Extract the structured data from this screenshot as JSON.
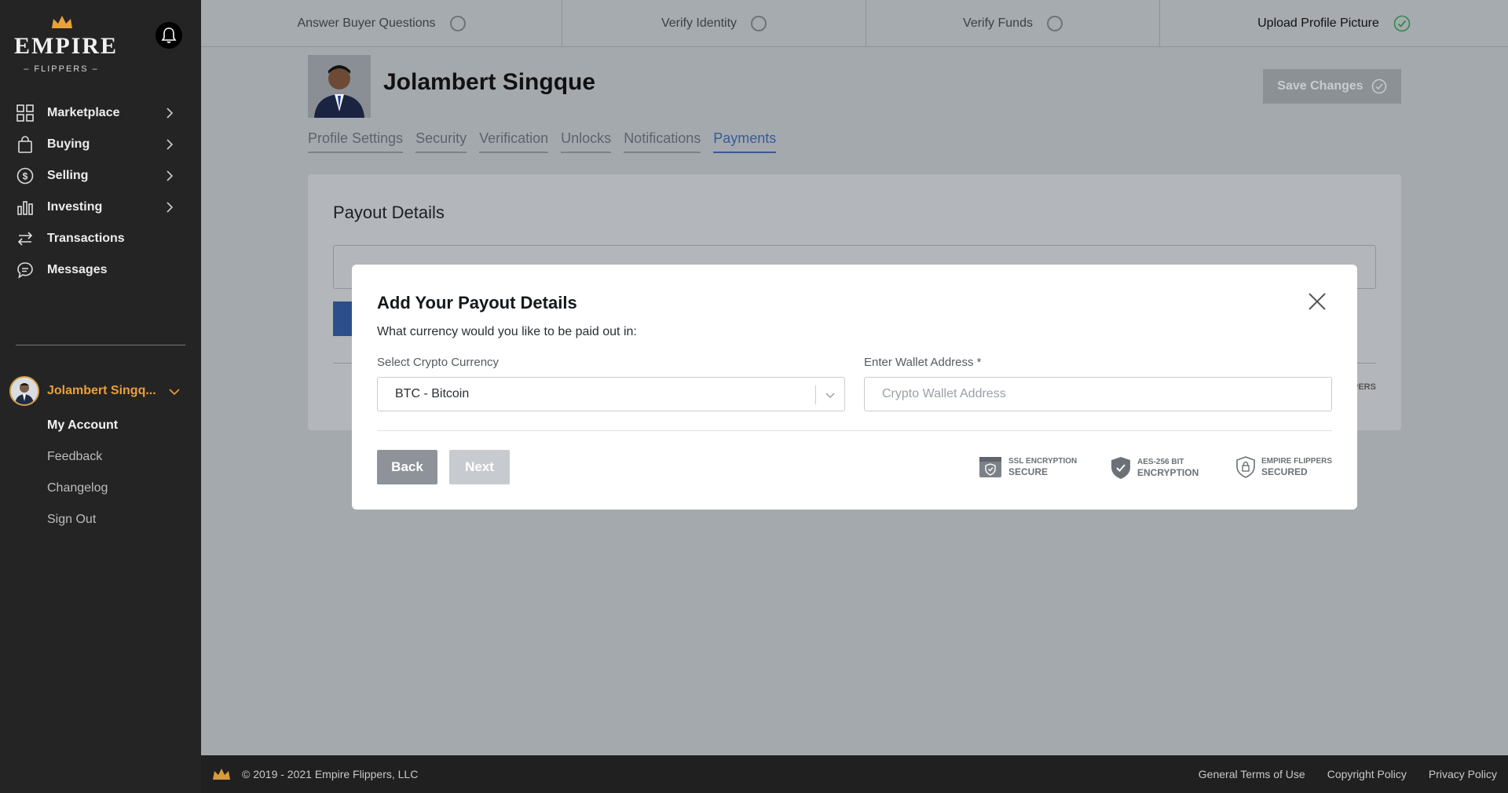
{
  "brand": {
    "name": "EMPIRE",
    "sub": "FLIPPERS"
  },
  "sidebar": {
    "items": [
      {
        "label": "Marketplace",
        "icon": "grid-icon",
        "has_chevron": true
      },
      {
        "label": "Buying",
        "icon": "shopping-bag-icon",
        "has_chevron": true
      },
      {
        "label": "Selling",
        "icon": "dollar-circle-icon",
        "has_chevron": true
      },
      {
        "label": "Investing",
        "icon": "bar-chart-icon",
        "has_chevron": true
      },
      {
        "label": "Transactions",
        "icon": "arrows-swap-icon",
        "has_chevron": false
      },
      {
        "label": "Messages",
        "icon": "chat-bubble-icon",
        "has_chevron": false
      }
    ],
    "user": {
      "name": "Jolambert Singq..."
    },
    "account_menu": [
      "My Account",
      "Feedback",
      "Changelog",
      "Sign Out"
    ]
  },
  "steps": [
    {
      "label": "Answer Buyer Questions",
      "done": false
    },
    {
      "label": "Verify Identity",
      "done": false
    },
    {
      "label": "Verify Funds",
      "done": false
    },
    {
      "label": "Upload Profile Picture",
      "done": true
    }
  ],
  "profile": {
    "name": "Jolambert Singque",
    "save_label": "Save Changes",
    "tabs": [
      "Profile Settings",
      "Security",
      "Verification",
      "Unlocks",
      "Notifications",
      "Payments"
    ],
    "active_tab": "Payments"
  },
  "card": {
    "title": "Payout Details",
    "partial_badge": "PERS"
  },
  "modal": {
    "title": "Add Your Payout Details",
    "subtitle": "What currency would you like to be paid out in:",
    "currency_label": "Select Crypto Currency",
    "currency_value": "BTC - Bitcoin",
    "wallet_label": "Enter Wallet Address *",
    "wallet_placeholder": "Crypto Wallet Address",
    "wallet_value": "",
    "back_label": "Back",
    "next_label": "Next",
    "badges": [
      {
        "line1": "SSL ENCRYPTION",
        "line2": "SECURE",
        "icon": "ssl-browser-icon"
      },
      {
        "line1": "AES-256 BIT",
        "line2": "ENCRYPTION",
        "icon": "shield-check-icon"
      },
      {
        "line1": "EMPIRE FLIPPERS",
        "line2": "SECURED",
        "icon": "lock-shield-icon"
      }
    ]
  },
  "footer": {
    "copyright": "© 2019 - 2021 Empire Flippers, LLC",
    "links": [
      "General Terms of Use",
      "Copyright Policy",
      "Privacy Policy"
    ]
  },
  "colors": {
    "accent": "#e9a13b",
    "primary": "#3a5a96",
    "sidebar_bg": "#242424"
  }
}
